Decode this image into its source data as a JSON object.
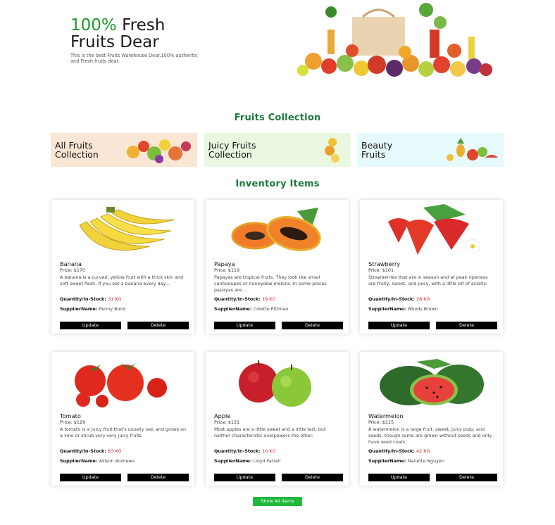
{
  "hero": {
    "title_accent": "100%",
    "title_rest": " Fresh",
    "title_line2": "Fruits Dear",
    "description": "This is the best Fruits Warehouse Dear.100% authentic and Fresh fruits dear."
  },
  "collection": {
    "title": "Fruits Collection",
    "categories": [
      {
        "label": "All Fruits\nCollection"
      },
      {
        "label": "Juicy Fruits\nCollection"
      },
      {
        "label": "Beauty\nFruits"
      }
    ]
  },
  "inventory": {
    "title": "Inventory Items",
    "price_prefix": "Price: ",
    "qty_label": "Quantity/In-Stock: ",
    "supplier_label": "SupplierName: ",
    "update_label": "Update",
    "delete_label": "Delete",
    "items": [
      {
        "name": "Banana",
        "price": "$170",
        "description": "A banana is a curved, yellow fruit with a thick skin and soft sweet flesh. If you eat a banana every day...",
        "quantity": "31 KG",
        "supplier": "Penny Bond"
      },
      {
        "name": "Papaya",
        "price": "$119",
        "description": "Papayas are tropical fruits. They look like small cantaloupes or honeydew melons. In some places papayas are...",
        "quantity": "19 KG",
        "supplier": "Colette Pittman"
      },
      {
        "name": "Strawberry",
        "price": "$101",
        "description": "Strawberries that are in season and at peak ripeness are fruity, sweet, and juicy, with a little bit of acidity.",
        "quantity": "28 KG",
        "supplier": "Woods Brown"
      },
      {
        "name": "Tomato",
        "price": "$129",
        "description": "A tomato is a juicy fruit that's usually red, and grows on a vine or shrub.very very juicy fruits",
        "quantity": "63 KG",
        "supplier": "Allison Andrews"
      },
      {
        "name": "Apple",
        "price": "$131",
        "description": "Most apples are a little sweet and a little tart, but neither characteristic overpowers the other.",
        "quantity": "10 KG",
        "supplier": "Lloyd Farrell"
      },
      {
        "name": "Watermelon",
        "price": "$115",
        "description": "A watermelon is a large fruit. sweet, juicy pulp; and seeds, though some are grown without seeds and only have seed coats.",
        "quantity": "42 KG",
        "supplier": "Nanette Nguyen"
      }
    ]
  },
  "show_all_label": "Show All Items",
  "colors": {
    "accent_green": "#1b7a3a",
    "button_green": "#1fb83a",
    "quantity_red": "#e02020"
  }
}
